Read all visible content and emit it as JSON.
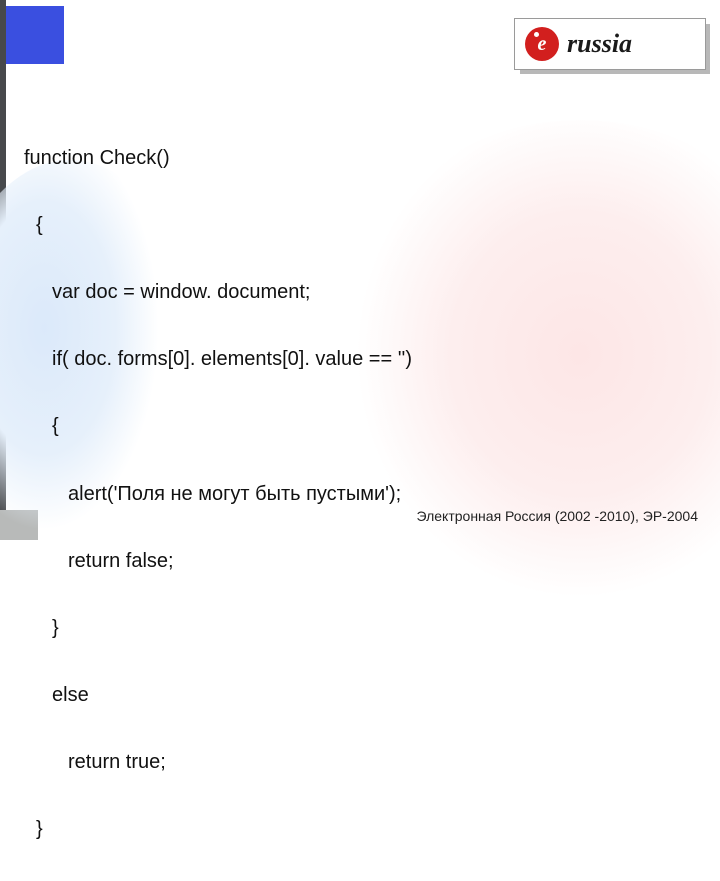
{
  "logo": {
    "e_letter": "e",
    "text": "russia"
  },
  "code": {
    "l1": "function Check()",
    "l2": "{",
    "l3": "var doc = window. document;",
    "l4": "if( doc. forms[0]. elements[0]. value == '')",
    "l5": "{",
    "l6": "alert('Поля не могут быть пустыми');",
    "l7": "return false;",
    "l8": "}",
    "l9": "else",
    "l10": "return true;",
    "l11": "}"
  },
  "footer": "Электронная Россия (2002 -2010), ЭР-2004"
}
